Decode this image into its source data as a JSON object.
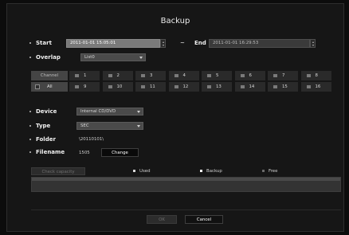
{
  "dialog": {
    "title": "Backup"
  },
  "start": {
    "label": "Start",
    "value": "2011-01-01 15:05:01"
  },
  "end": {
    "label": "End",
    "value": "2011-01-01 16:29:53"
  },
  "range_separator": "~",
  "overlap": {
    "label": "Overlap",
    "value": "List0"
  },
  "channel": {
    "header": "Channel",
    "all_label": "All",
    "items": [
      "1",
      "2",
      "3",
      "4",
      "5",
      "6",
      "7",
      "8",
      "9",
      "10",
      "11",
      "12",
      "13",
      "14",
      "15",
      "16"
    ]
  },
  "device": {
    "label": "Device",
    "value": "Internal CD/DVD"
  },
  "type": {
    "label": "Type",
    "value": "SEC"
  },
  "folder": {
    "label": "Folder",
    "value": "\\20110101\\"
  },
  "filename": {
    "label": "Filename",
    "value": "1505",
    "button": "Change"
  },
  "capacity": {
    "check_label": "Check capacity",
    "legend": [
      {
        "label": "Used",
        "color": "#d9d9d9"
      },
      {
        "label": "Backup",
        "color": "#ffffff"
      },
      {
        "label": "Free",
        "color": "#6a6a6a"
      }
    ]
  },
  "footer": {
    "ok": "OK",
    "cancel": "Cancel"
  }
}
